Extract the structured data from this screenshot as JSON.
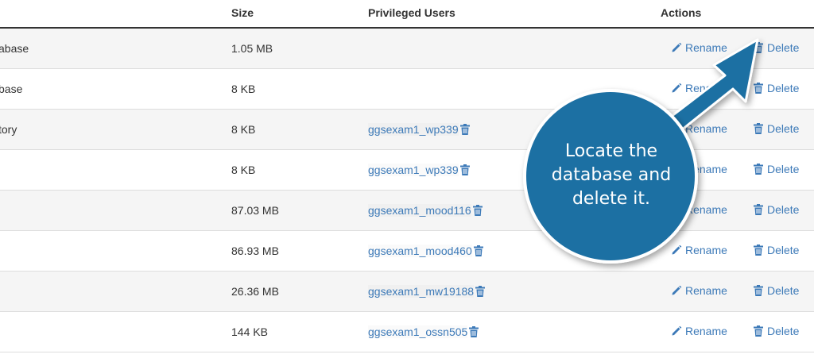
{
  "table": {
    "headers": {
      "size": "Size",
      "privileged_users": "Privileged Users",
      "actions": "Actions"
    },
    "rows": [
      {
        "name": "abase",
        "size": "1.05 MB",
        "user": ""
      },
      {
        "name": "base",
        "size": "8 KB",
        "user": ""
      },
      {
        "name": "tory",
        "size": "8 KB",
        "user": "ggsexam1_wp339"
      },
      {
        "name": "",
        "size": "8 KB",
        "user": "ggsexam1_wp339"
      },
      {
        "name": "",
        "size": "87.03 MB",
        "user": "ggsexam1_mood116"
      },
      {
        "name": "",
        "size": "86.93 MB",
        "user": "ggsexam1_mood460"
      },
      {
        "name": "",
        "size": "26.36 MB",
        "user": "ggsexam1_mw19188"
      },
      {
        "name": "",
        "size": "144 KB",
        "user": "ggsexam1_ossn505"
      }
    ],
    "actions": {
      "rename_label": "Rename",
      "delete_label": "Delete"
    }
  },
  "callout": {
    "line1": "Locate the",
    "line2": "database and",
    "line3": "delete it."
  },
  "colors": {
    "link": "#3d7ab8",
    "callout_fill": "#1f6fa3",
    "callout_border": "#ffffff"
  },
  "icons": {
    "rename": "pencil-icon",
    "delete": "trash-icon",
    "remove_user": "trash-icon"
  }
}
